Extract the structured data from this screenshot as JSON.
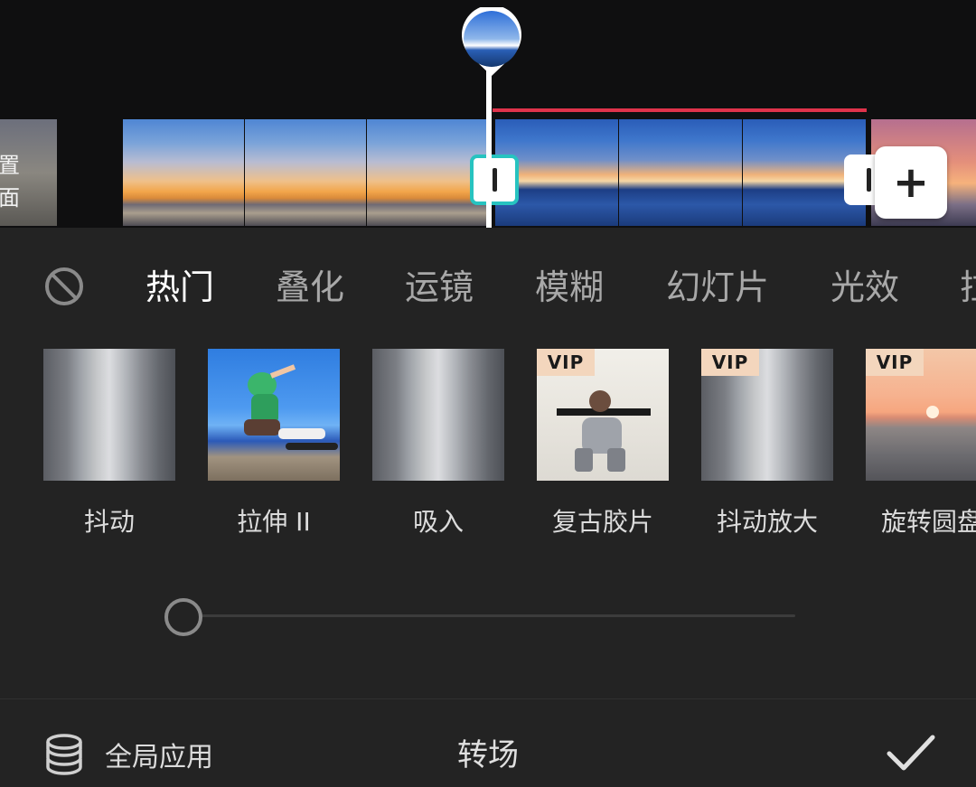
{
  "timeline": {
    "left_clip_text_line1": "置",
    "left_clip_text_line2": "面",
    "add_label": "+"
  },
  "tabs": {
    "items": [
      "热门",
      "叠化",
      "运镜",
      "模糊",
      "幻灯片",
      "光效",
      "拉"
    ],
    "active": "热门"
  },
  "effects": [
    {
      "label": "抖动",
      "vip": ""
    },
    {
      "label": "拉伸 II",
      "vip": ""
    },
    {
      "label": "吸入",
      "vip": ""
    },
    {
      "label": "复古胶片",
      "vip": "VIP"
    },
    {
      "label": "抖动放大",
      "vip": "VIP"
    },
    {
      "label": "旋转圆盘",
      "vip": "VIP"
    }
  ],
  "slider": {
    "value_fraction": 0.0
  },
  "bottom": {
    "apply_all_label": "全局应用",
    "title": "转场"
  },
  "colors": {
    "accent_teal": "#27c3c0",
    "red_line": "#e0334b",
    "panel_bg": "#232323"
  }
}
